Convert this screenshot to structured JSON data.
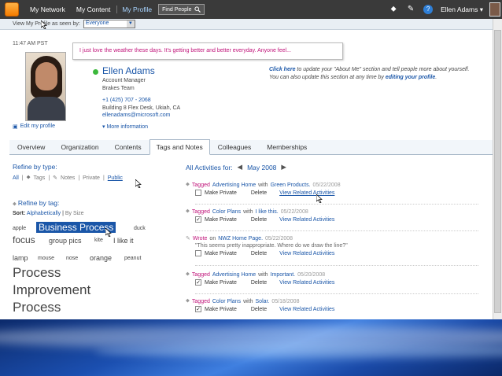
{
  "topnav": {
    "links": [
      "My Network",
      "My Content",
      "My Profile"
    ],
    "find_people": "Find People",
    "user": "Ellen Adams"
  },
  "viewbar": {
    "label": "View My Profile as seen by:",
    "value": "Everyone"
  },
  "profile": {
    "time": "11:47 AM PST",
    "status": "I just love the weather these days. It's getting better and better everyday. Anyone feel...",
    "name": "Ellen Adams",
    "title": "Account Manager",
    "team": "Brakes Team",
    "phone": "+1 (425) 707 - 2068",
    "location": "Building 8 Flex Desk, Ukiah, CA",
    "email": "ellenadams@microsoft.com",
    "edit_label": "Edit my profile",
    "more_info": "More information",
    "about": {
      "click_here": "Click here",
      "text1": " to update your \"About Me\" section and tell people more about yourself. You can also update this section at any time by ",
      "editing": "editing your profile",
      "text2": "."
    }
  },
  "tabs": [
    "Overview",
    "Organization",
    "Contents",
    "Tags and Notes",
    "Colleagues",
    "Memberships"
  ],
  "refine_type": {
    "header": "Refine by type:",
    "items": [
      "All",
      "Tags",
      "Notes",
      "Private",
      "Public"
    ]
  },
  "refine_tag": {
    "header": "Refine by tag:",
    "sort_label": "Sort:",
    "sort_alpha": "Alphabetically",
    "sort_size": "By Size",
    "tags": [
      "apple",
      "Business Process",
      "duck",
      "focus",
      "group pics",
      "kite",
      "I like it",
      "lamp",
      "mouse",
      "nose",
      "orange",
      "peanut",
      "Process",
      "Improvement",
      "Process"
    ]
  },
  "activities": {
    "header": "All Activities for:",
    "month": "May 2008",
    "make_private": "Make Private",
    "delete": "Delete",
    "related": "View Related Activities",
    "items": [
      {
        "verb": "Tagged",
        "subject": "Advertising Home",
        "with": " with ",
        "tag": "Green Products.",
        "date": "05/22/2008",
        "quote": "",
        "checked": false
      },
      {
        "verb": "Tagged",
        "subject": "Color Plans",
        "with": " with ",
        "tag": "I like this.",
        "date": "05/22/2008",
        "quote": "",
        "checked": true
      },
      {
        "verb": "Wrote",
        "subject": "NWZ Home Page.",
        "with": " on ",
        "tag": "",
        "date": "05/22/2008",
        "quote": "\"This seems pretty inappropriate. Where do we draw the line?\"",
        "checked": false
      },
      {
        "verb": "Tagged",
        "subject": "Advertising Home",
        "with": " with ",
        "tag": "Important.",
        "date": "05/20/2008",
        "quote": "",
        "checked": true
      },
      {
        "verb": "Tagged",
        "subject": "Color Plans",
        "with": " with ",
        "tag": "Solar.",
        "date": "05/18/2008",
        "quote": "",
        "checked": true
      }
    ]
  }
}
